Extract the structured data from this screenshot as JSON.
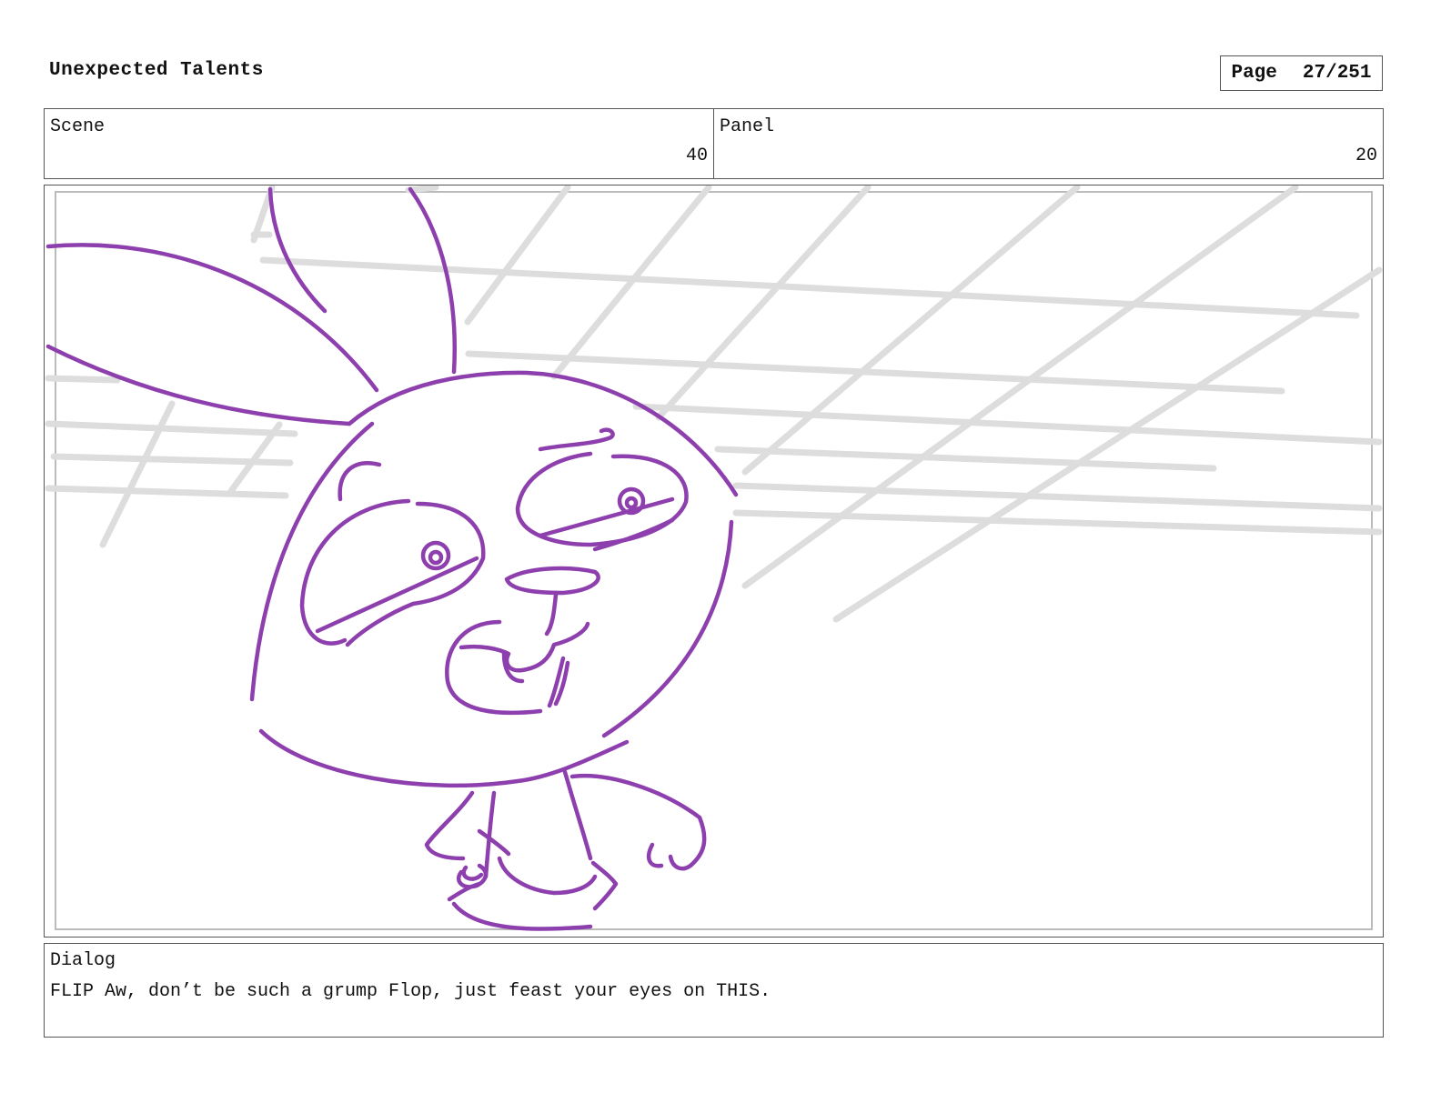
{
  "header": {
    "title": "Unexpected Talents",
    "page_label": "Page",
    "page_number": "27/251"
  },
  "info": {
    "scene_label": "Scene",
    "scene_value": "40",
    "panel_label": "Panel",
    "panel_value": "20"
  },
  "dialog": {
    "label": "Dialog",
    "text": "FLIP Aw, don’t be such a grump Flop, just feast your eyes on THIS."
  },
  "colors": {
    "sketch_line": "#8e3fae",
    "grid_line": "#dddddd",
    "border": "#555555"
  }
}
